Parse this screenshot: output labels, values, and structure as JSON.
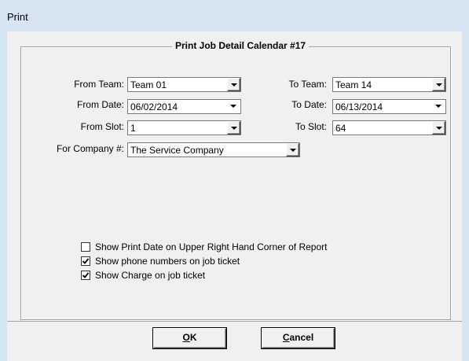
{
  "window": {
    "title": "Print"
  },
  "group": {
    "title": "Print Job Detail Calendar #17"
  },
  "fields": {
    "from_team": {
      "label": "From Team:",
      "value": "Team 01"
    },
    "to_team": {
      "label": "To Team:",
      "value": "Team 14"
    },
    "from_date": {
      "label": "From Date:",
      "value": "06/02/2014"
    },
    "to_date": {
      "label": "To Date:",
      "value": "06/13/2014"
    },
    "from_slot": {
      "label": "From Slot:",
      "value": "1"
    },
    "to_slot": {
      "label": "To Slot:",
      "value": "64"
    },
    "company": {
      "label": "For Company #:",
      "value": "The Service Company"
    }
  },
  "options": [
    {
      "label": "Show Print Date on Upper Right Hand Corner of Report",
      "checked": false
    },
    {
      "label": "Show phone numbers on job ticket",
      "checked": true
    },
    {
      "label": "Show Charge on job ticket",
      "checked": true
    }
  ],
  "buttons": {
    "ok": {
      "mnemonic": "O",
      "rest": "K"
    },
    "cancel": {
      "mnemonic": "C",
      "rest": "ancel"
    }
  },
  "icons": {
    "dropdown": "chevron-down-icon",
    "check": "checkmark-icon"
  }
}
